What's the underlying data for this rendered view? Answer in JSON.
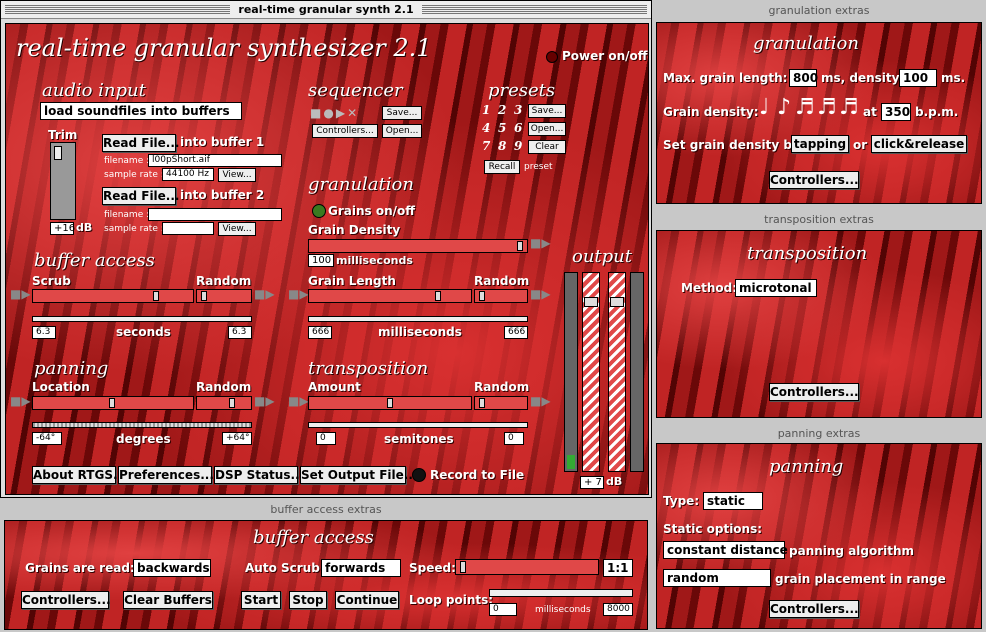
{
  "main_window": {
    "title": "real-time granular synth 2.1",
    "heading": "real-time granular synthesizer 2.1",
    "power_label": "Power on/off"
  },
  "audio_input": {
    "heading": "audio input",
    "dropdown": "load soundfiles into buffers",
    "trim_label": "Trim",
    "trim_value": "+16",
    "trim_unit": "dB",
    "buf1": {
      "read_btn": "Read File...",
      "into": "into buffer 1",
      "filename_lbl": "filename :",
      "filename": "l00pShort.aif",
      "sr_lbl": "sample rate :",
      "sr": "44100 Hz",
      "view": "View..."
    },
    "buf2": {
      "read_btn": "Read File...",
      "into": "into buffer 2",
      "filename_lbl": "filename :",
      "filename": "",
      "sr_lbl": "sample rate :",
      "sr": "",
      "view": "View..."
    }
  },
  "sequencer": {
    "heading": "sequencer",
    "save": "Save...",
    "controllers": "Controllers...",
    "open": "Open..."
  },
  "presets": {
    "heading": "presets",
    "nums": [
      "1",
      "2",
      "3",
      "4",
      "5",
      "6",
      "7",
      "8",
      "9"
    ],
    "save": "Save...",
    "open": "Open...",
    "clear": "Clear",
    "recall": "Recall",
    "preset_lbl": "preset"
  },
  "granulation": {
    "heading": "granulation",
    "grains_toggle": "Grains on/off",
    "density_lbl": "Grain Density",
    "density_val": "100",
    "density_unit": "milliseconds",
    "length_lbl": "Grain Length",
    "random_lbl": "Random",
    "length_min": "666",
    "length_unit": "milliseconds",
    "length_max": "666"
  },
  "buffer_access": {
    "heading": "buffer access",
    "scrub_lbl": "Scrub",
    "random_lbl": "Random",
    "min": "6.3",
    "unit": "seconds",
    "max": "6.3"
  },
  "panning": {
    "heading": "panning",
    "location_lbl": "Location",
    "random_lbl": "Random",
    "min": "-64°",
    "unit": "degrees",
    "max": "+64°"
  },
  "transposition": {
    "heading": "transposition",
    "amount_lbl": "Amount",
    "random_lbl": "Random",
    "min": "0",
    "unit": "semitones",
    "max": "0"
  },
  "output": {
    "heading": "output",
    "value": "+ 7",
    "unit": "dB"
  },
  "bottom_buttons": {
    "about": "About RTGS...",
    "prefs": "Preferences...",
    "dsp": "DSP Status...",
    "set_output": "Set Output File...",
    "record": "Record to File"
  },
  "gran_extras": {
    "title": "granulation extras",
    "heading": "granulation",
    "max_len_lbl": "Max. grain length:",
    "max_len": "800",
    "ms_density": "ms, density:",
    "density": "100",
    "ms": "ms.",
    "grain_density_lbl": "Grain density:",
    "at": "at",
    "bpm": "350",
    "bpm_unit": "b.p.m.",
    "set_by": "Set grain density by",
    "tapping": "tapping",
    "or": "or",
    "click": "click&release",
    "controllers": "Controllers..."
  },
  "trans_extras": {
    "title": "transposition extras",
    "heading": "transposition",
    "method_lbl": "Method:",
    "method": "microtonal",
    "controllers": "Controllers..."
  },
  "pan_extras": {
    "title": "panning extras",
    "heading": "panning",
    "type_lbl": "Type:",
    "type": "static",
    "static_lbl": "Static options:",
    "algo": "constant distance",
    "algo_lbl": "panning algorithm",
    "placement": "random",
    "placement_lbl": "grain placement in range",
    "controllers": "Controllers..."
  },
  "buf_extras": {
    "title": "buffer access extras",
    "heading": "buffer access",
    "read_lbl": "Grains are read:",
    "read": "backwards",
    "auto_lbl": "Auto Scrub:",
    "auto": "forwards",
    "speed_lbl": "Speed:",
    "speed": "1:1",
    "controllers": "Controllers...",
    "clear": "Clear Buffers",
    "start": "Start",
    "stop": "Stop",
    "continue": "Continue",
    "loop_lbl": "Loop points:",
    "loop_min": "0",
    "loop_unit": "milliseconds",
    "loop_max": "8000"
  }
}
